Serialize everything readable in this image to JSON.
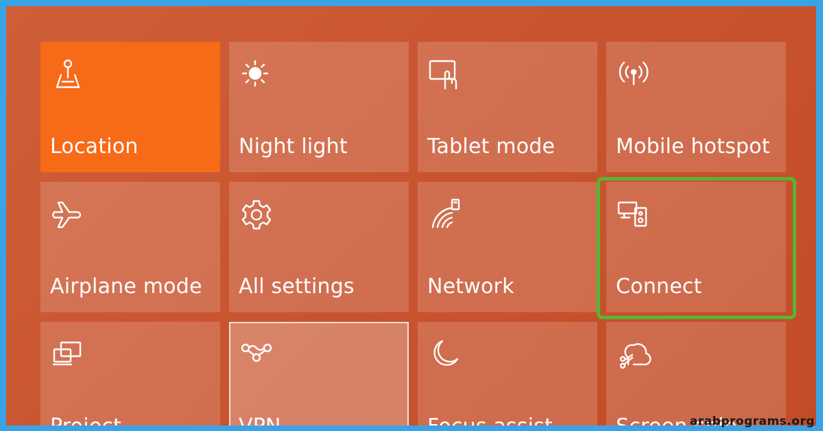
{
  "quick_actions": {
    "tiles": [
      {
        "label": "Location",
        "icon": "location-icon",
        "state": "on"
      },
      {
        "label": "Night light",
        "icon": "brightness-icon",
        "state": "off"
      },
      {
        "label": "Tablet mode",
        "icon": "tablet-mode-icon",
        "state": "off"
      },
      {
        "label": "Mobile hotspot",
        "icon": "hotspot-icon",
        "state": "off"
      },
      {
        "label": "Airplane mode",
        "icon": "airplane-icon",
        "state": "off"
      },
      {
        "label": "All settings",
        "icon": "gear-icon",
        "state": "off"
      },
      {
        "label": "Network",
        "icon": "network-icon",
        "state": "off"
      },
      {
        "label": "Connect",
        "icon": "connect-icon",
        "state": "off",
        "highlighted": true
      },
      {
        "label": "Project",
        "icon": "project-icon",
        "state": "off"
      },
      {
        "label": "VPN",
        "icon": "vpn-icon",
        "state": "off"
      },
      {
        "label": "Focus assist",
        "icon": "moon-icon",
        "state": "off"
      },
      {
        "label": "Screen snip",
        "icon": "snip-icon",
        "state": "off"
      }
    ]
  },
  "colors": {
    "background": "#c95530",
    "active_tile": "#f76a18",
    "highlight": "#57b534",
    "frame_border": "#3aa3e6"
  },
  "watermark": "arabprograms.org"
}
